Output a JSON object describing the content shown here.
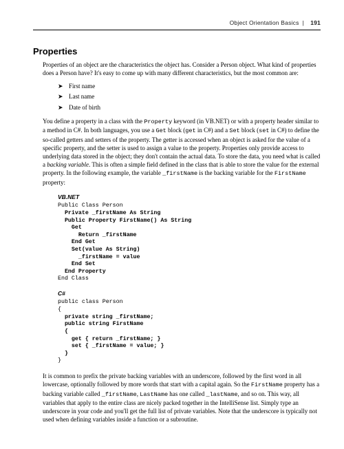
{
  "running_head": {
    "section": "Object Orientation Basics",
    "separator": "|",
    "page": "191"
  },
  "h2": "Properties",
  "intro": "Properties of an object are the characteristics the object has. Consider a Person object. What kind of properties does a Person have? It's easy to come up with many different characteristics, but the most common are:",
  "bullets": [
    "First name",
    "Last name",
    "Date of birth"
  ],
  "para2_a": "You define a property in a class with the ",
  "para2_prop": "Property",
  "para2_b": " keyword (in VB.NET) or with a property header similar to a method in C#. In both languages, you use a ",
  "para2_get": "Get",
  "para2_c": " block (",
  "para2_getcs": "get",
  "para2_d": " in C#) and a ",
  "para2_set": "Set",
  "para2_e": " block (",
  "para2_setcs": "set",
  "para2_f": " in C#) to define the so-called getters and setters of the property. The getter is accessed when an object is asked for the value of a specific property, and the setter is used to assign a value to the property. Properties only provide access to underlying data stored in the object; they don't contain the actual data. To store the data, you need what is called a ",
  "para2_bv": "backing variable",
  "para2_g": ". This is often a simple field defined in the class that is able to store the value for the external property. In the following example, the variable ",
  "para2_fld": "_firstName",
  "para2_h": " is the backing variable for the ",
  "para2_propname": "FirstName",
  "para2_i": " property:",
  "label_vb": "VB.NET",
  "vb_line1": "Public Class Person",
  "vb_line2": "  Private _firstName As String",
  "vb_line3": "  Public Property FirstName() As String",
  "vb_line4": "    Get",
  "vb_line5": "      Return _firstName",
  "vb_line6": "    End Get",
  "vb_line7": "    Set(value As String)",
  "vb_line8": "      _firstName = value",
  "vb_line9": "    End Set",
  "vb_line10": "  End Property",
  "vb_line11": "End Class",
  "label_cs": "C#",
  "cs_line1": "public class Person",
  "cs_line2": "{",
  "cs_line3": "  private string _firstName;",
  "cs_line4": "  public string FirstName",
  "cs_line5": "  {",
  "cs_line6": "    get { return _firstName; }",
  "cs_line7": "    set { _firstName = value; }",
  "cs_line8": "  }",
  "cs_line9": "}",
  "para3_a": "It is common to prefix the private backing variables with an underscore, followed by the first word in all lowercase, optionally followed by more words that start with a capital again. So the ",
  "para3_fn": "FirstName",
  "para3_b": " property has a backing variable called ",
  "para3_fnv": "_firstName",
  "para3_c": ", ",
  "para3_ln": "LastName",
  "para3_d": " has one called ",
  "para3_lnv": "_lastName",
  "para3_e": ", and so on. This way, all variables that apply to the entire class are nicely packed together in the IntelliSense list. Simply type an underscore in your code and you'll get the full list of private variables. Note that the underscore is typically not used when defining variables inside a function or a subroutine."
}
